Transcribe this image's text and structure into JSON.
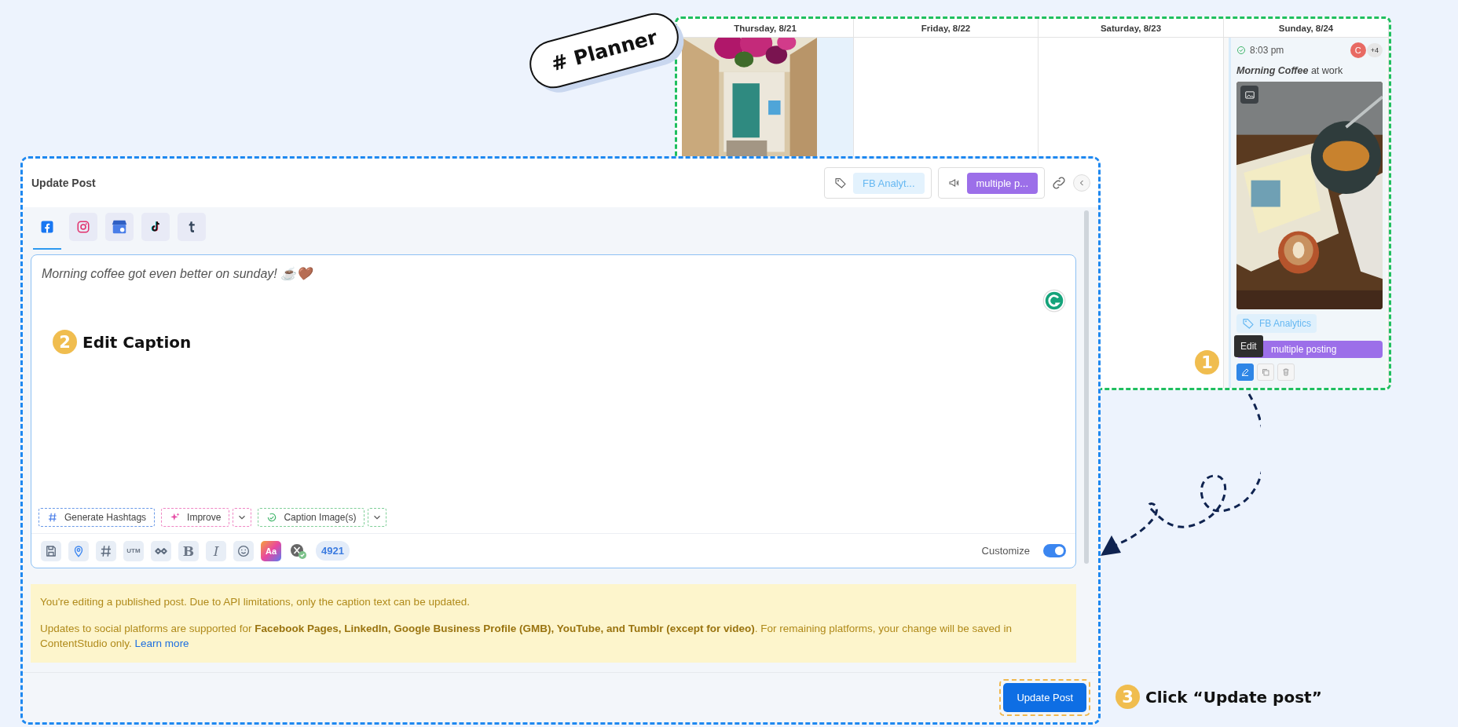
{
  "callout": {
    "text": "# Planner"
  },
  "planner": {
    "days": [
      {
        "label": "Thursday, 8/21",
        "kind": "picture"
      },
      {
        "label": "Friday, 8/22",
        "kind": "empty"
      },
      {
        "label": "Saturday, 8/23",
        "kind": "empty"
      },
      {
        "label": "Sunday, 8/24",
        "kind": "post"
      }
    ],
    "post": {
      "time": "8:03 pm",
      "avatar": "C",
      "extra": "+4",
      "title": "**Morning Coffee** at work",
      "label": "FB Analytics",
      "campaign": "multiple posting",
      "tooltip": "Edit"
    }
  },
  "steps": [
    {
      "number": "1"
    },
    {
      "number": "2",
      "text": "Edit Caption"
    },
    {
      "number": "3",
      "text": "Click “Update post”"
    }
  ],
  "update_post": {
    "title": "Update Post",
    "label_chip": "FB Analyt...",
    "campaign_chip": "multiple p...",
    "platforms": [
      {
        "kind": "facebook",
        "selected": true
      },
      {
        "kind": "instagram",
        "selected": false
      },
      {
        "kind": "store",
        "selected": false
      },
      {
        "kind": "tiktok",
        "selected": false
      },
      {
        "kind": "tumblr",
        "selected": false
      }
    ],
    "caption": "Morning coffee got even better on sunday! ☕🤎",
    "ai_actions": [
      {
        "kind": "hashtags",
        "label": "Generate Hashtags",
        "dropdown": false
      },
      {
        "kind": "improve",
        "label": "Improve",
        "dropdown": true
      },
      {
        "kind": "caption",
        "label": "Caption Image(s)",
        "dropdown": true
      }
    ],
    "tools": [
      {
        "kind": "save"
      },
      {
        "kind": "location"
      },
      {
        "kind": "hashtag"
      },
      {
        "kind": "utm",
        "label": "UTM"
      },
      {
        "kind": "link"
      },
      {
        "kind": "bold",
        "label": "B"
      },
      {
        "kind": "italic",
        "label": "I"
      },
      {
        "kind": "emoji"
      },
      {
        "kind": "style",
        "label": "Aa"
      },
      {
        "kind": "account"
      }
    ],
    "char_count": "4921",
    "customize": {
      "label": "Customize",
      "on": true
    },
    "notice": [
      "You're editing a published post. Due to API limitations, only the caption text can be updated.",
      "Updates to social platforms are supported for **Facebook Pages, LinkedIn, Google Business Profile (GMB), YouTube, and Tumblr (except for video)**. For remaining platforms, your change will be saved in ContentStudio only."
    ],
    "notice_link": "Learn more",
    "submit": "Update Post"
  }
}
